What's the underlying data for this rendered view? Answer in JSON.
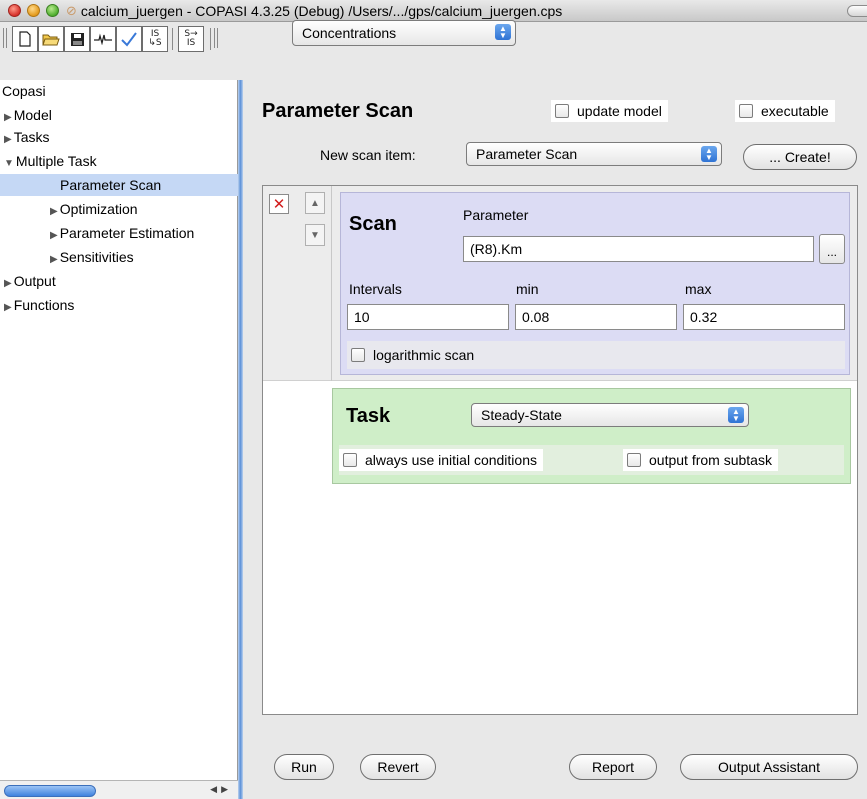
{
  "window": {
    "title": "calcium_juergen - COPASI 4.3.25 (Debug) /Users/.../gps/calcium_juergen.cps"
  },
  "toolbar": {
    "buttons": [
      "new-document",
      "open-folder",
      "save",
      "signal",
      "check"
    ],
    "is_to_s": {
      "top": "IS",
      "bottom": "↳S"
    },
    "s_to_is": {
      "top": "S→",
      "bottom": "IS"
    },
    "mode_combo": "Concentrations"
  },
  "sidebar": {
    "root": "Copasi",
    "items": [
      {
        "label": "Model",
        "expanded": false
      },
      {
        "label": "Tasks",
        "expanded": false
      },
      {
        "label": "Multiple Task",
        "expanded": true
      },
      {
        "label": "Parameter Scan",
        "selected": true
      },
      {
        "label": "Optimization",
        "expanded": false
      },
      {
        "label": "Parameter Estimation",
        "expanded": false
      },
      {
        "label": "Sensitivities",
        "expanded": false
      },
      {
        "label": "Output",
        "expanded": false
      },
      {
        "label": "Functions",
        "expanded": false
      }
    ]
  },
  "main": {
    "title": "Parameter Scan",
    "update_model": {
      "label": "update model",
      "checked": false
    },
    "executable": {
      "label": "executable",
      "checked": false
    },
    "new_scan_item_label": "New scan item:",
    "new_scan_item_value": "Parameter Scan",
    "create_label": "... Create!"
  },
  "scan": {
    "title": "Scan",
    "parameter_label": "Parameter",
    "parameter_value": "(R8).Km",
    "dots_label": "...",
    "intervals_label": "Intervals",
    "min_label": "min",
    "max_label": "max",
    "intervals_value": "10",
    "min_value": "0.08",
    "max_value": "0.32",
    "log_label": "logarithmic scan",
    "delete_glyph": "✕",
    "up_glyph": "▲",
    "down_glyph": "▼"
  },
  "task": {
    "title": "Task",
    "type": "Steady-State",
    "initial_label": "always use initial conditions",
    "output_label": "output from subtask"
  },
  "buttons": {
    "run": "Run",
    "revert": "Revert",
    "report": "Report",
    "output_assistant": "Output Assistant"
  }
}
